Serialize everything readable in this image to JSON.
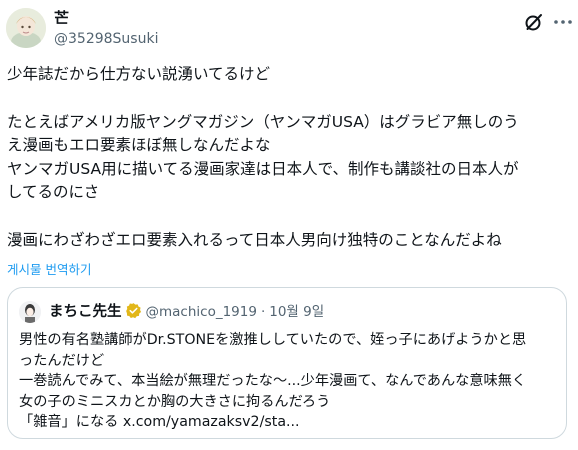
{
  "author": {
    "display_name": "芒",
    "handle": "@35298Susuki"
  },
  "tweet": {
    "lines": [
      "少年誌だから仕方ない説湧いてるけど",
      "",
      "たとえばアメリカ版ヤングマガジン（ヤンマガUSA）はグラビア無しのう",
      "え漫画もエロ要素ほぼ無しなんだよな",
      "ヤンマガUSA用に描いてる漫画家達は日本人で、制作も講談社の日本人が",
      "してるのにさ",
      "",
      "漫画にわざわざエロ要素入れるって日本人男向け独特のことなんだよね"
    ],
    "translate_label": "게시물 번역하기"
  },
  "quote": {
    "display_name": "まちこ先生",
    "handle": "@machico_1919",
    "separator": "·",
    "date": "10월 9일",
    "lines": [
      "男性の有名塾講師がDr.STONEを激推ししていたので、姪っ子にあげようかと思",
      "ったんだけど",
      "一巻読んでみて、本当絵が無理だったな〜...少年漫画て、なんであんな意味無く",
      "女の子のミニスカとか胸の大きさに拘るんだろう",
      "「雑音」になる x.com/yamazaksv2/sta..."
    ]
  },
  "icons": {
    "grok": "grok-icon",
    "more": "more-icon",
    "verified": "verified-badge-icon"
  },
  "colors": {
    "link_blue": "#1d9bf0",
    "verified_gold": "#e2b719",
    "muted": "#536471",
    "border": "#cfd9de"
  }
}
